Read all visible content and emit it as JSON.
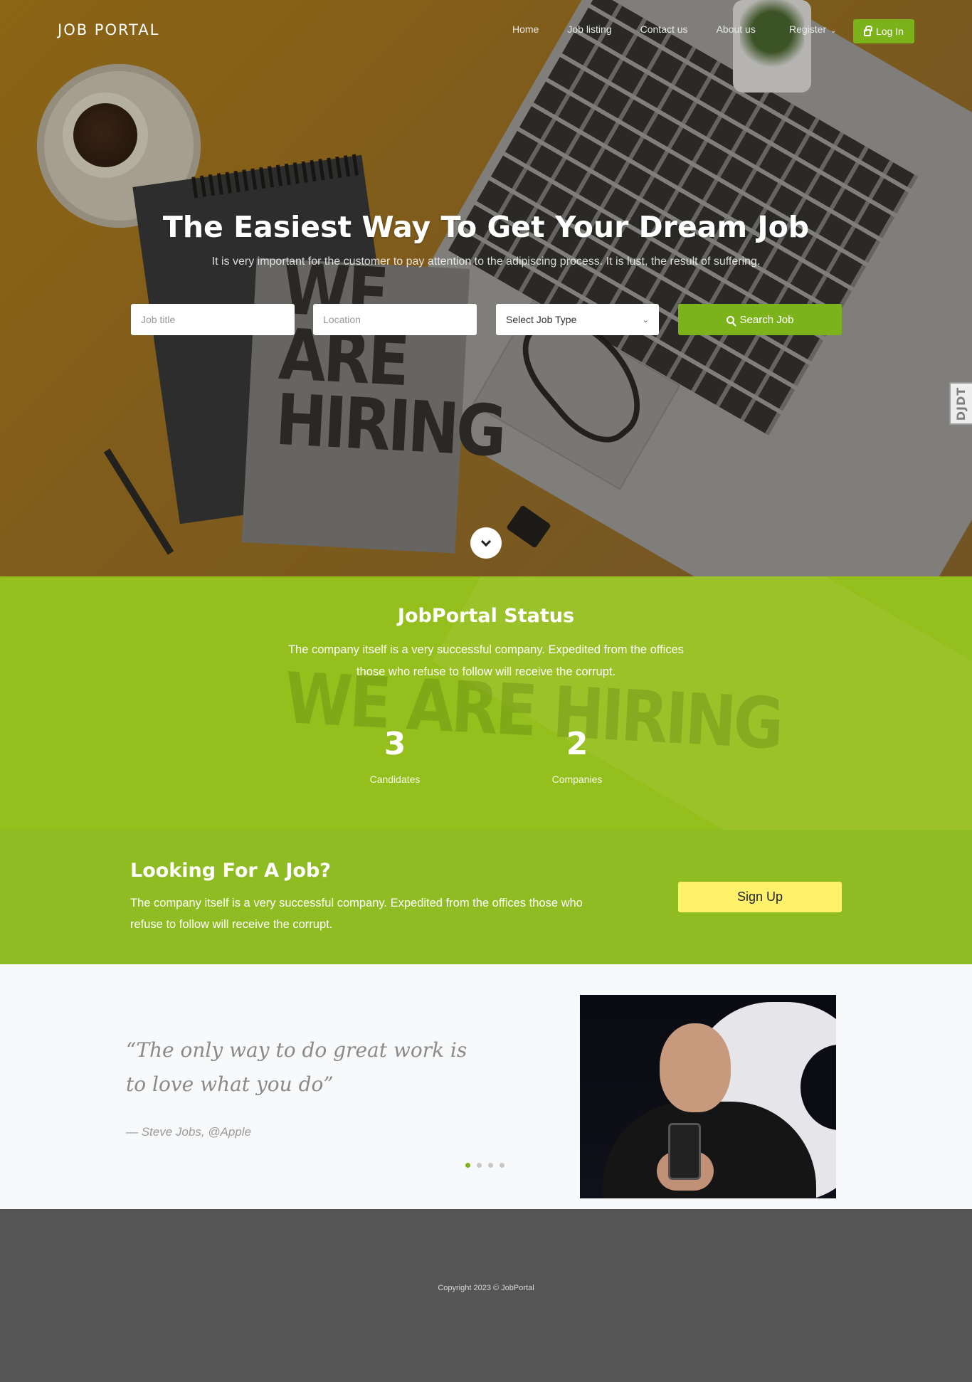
{
  "nav": {
    "logo": "JOB PORTAL",
    "links": [
      "Home",
      "Job listing",
      "Contact us",
      "About us"
    ],
    "register_label": "Register",
    "login_label": "Log In"
  },
  "hero": {
    "title": "The Easiest Way To Get Your Dream Job",
    "subtitle": "It is very important for the customer to pay attention to the adipiscing process. It is lust, the result of suffering.",
    "search": {
      "job_title_placeholder": "Job title",
      "location_placeholder": "Location",
      "job_type_selected": "Select Job Type",
      "button_label": "Search Job"
    },
    "side_tab": "DJDT",
    "background_text": "WE ARE HIRING"
  },
  "status": {
    "title": "JobPortal Status",
    "description": "The company itself is a very successful company. Expedited from the offices those who refuse to follow will receive the corrupt.",
    "stats": [
      {
        "value": "3",
        "label": "Candidates"
      },
      {
        "value": "2",
        "label": "Companies"
      }
    ]
  },
  "cta": {
    "title": "Looking For A Job?",
    "description": "The company itself is a very successful company. Expedited from the offices those who refuse to follow will receive the corrupt.",
    "button_label": "Sign Up"
  },
  "testimonial": {
    "quote": "“The only way to do great work is to love what you do”",
    "author": "— Steve Jobs, @Apple",
    "slides": 4,
    "active_slide": 1
  },
  "footer": {
    "copyright": "Copyright 2023 © JobPortal"
  },
  "colors": {
    "accent_green": "#7cb31a",
    "status_green": "#95bf1c",
    "cta_green": "#8fbc22",
    "signup_yellow": "#fff26a",
    "footer_grey": "#555556"
  }
}
